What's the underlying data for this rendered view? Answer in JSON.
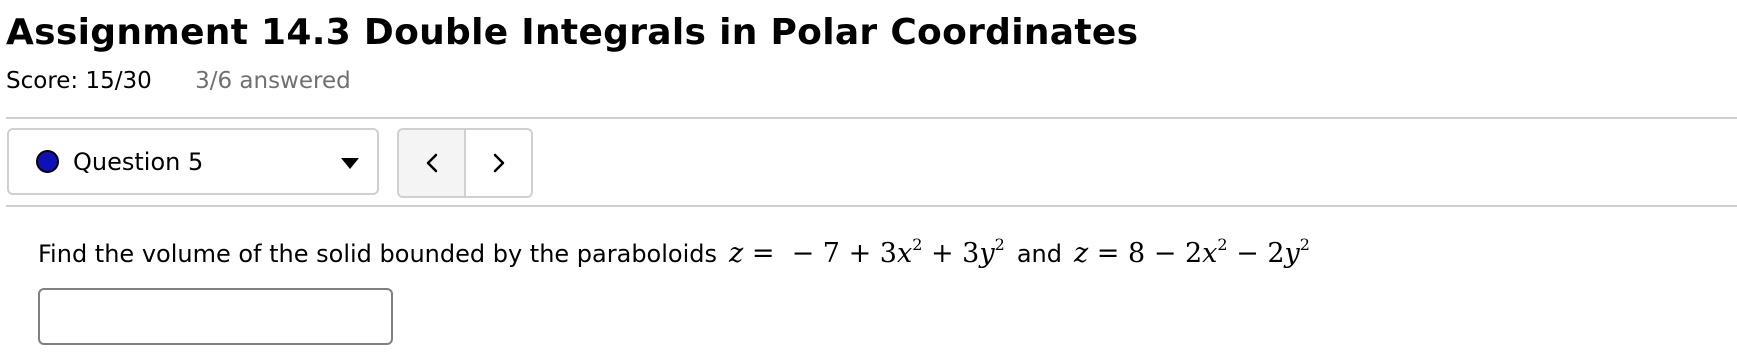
{
  "header": {
    "title": "Assignment 14.3 Double Integrals in Polar Coordinates",
    "score": "Score: 15/30",
    "answered": "3/6 answered"
  },
  "question_nav": {
    "selected": "Question 5",
    "status_color": "#1010b8",
    "prev_icon": "chevron-left-icon",
    "next_icon": "chevron-right-icon"
  },
  "question": {
    "prompt": "Find the volume of the solid bounded by the paraboloids",
    "connector": "and",
    "surface1": "z = − 7 + 3x² + 3y²",
    "surface2": "z = 8 − 2x² − 2y²"
  },
  "answer": {
    "value": "",
    "placeholder": ""
  }
}
